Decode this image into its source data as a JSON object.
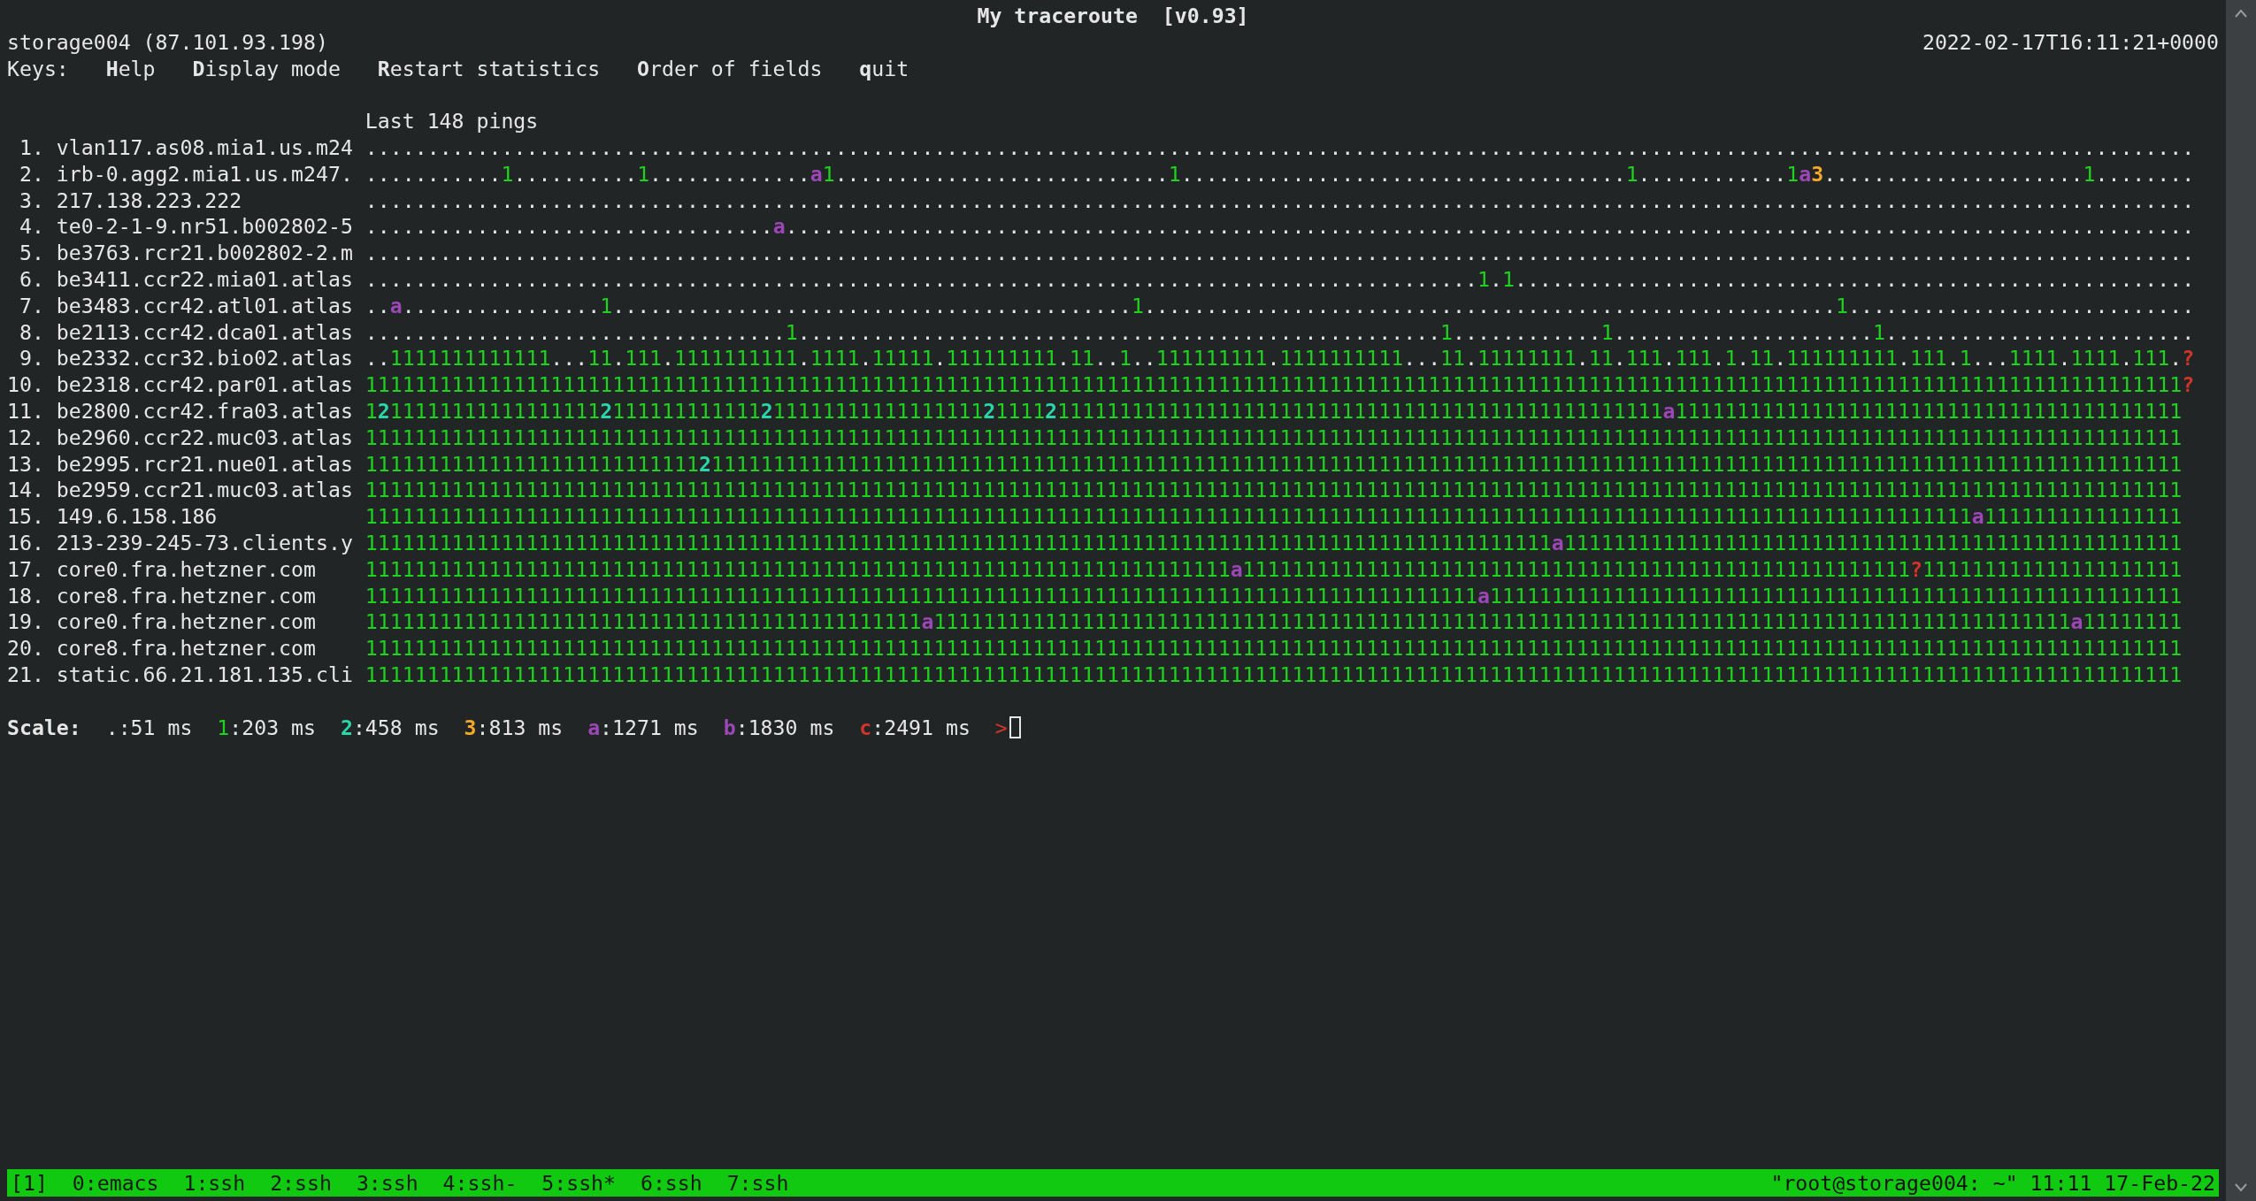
{
  "title": "My traceroute  [v0.93]",
  "host": "storage004 (87.101.93.198)",
  "timestamp": "2022-02-17T16:11:21+0000",
  "keys": {
    "label": "Keys:",
    "items": [
      "**H**elp",
      "**D**isplay mode",
      "**R**estart statistics",
      "**O**rder of fields",
      "**q**uit"
    ]
  },
  "pings_header": "Last 148 pings",
  "hops": [
    {
      "number": "1.",
      "host": "vlan117.as08.mia1.us.m24",
      "pings": "...................................................................................................................................................."
    },
    {
      "number": "2.",
      "host": "irb-0.agg2.mia1.us.m247.",
      "pings": "...........1..........1.............a1...........................1....................................1............1a3.....................1........"
    },
    {
      "number": "3.",
      "host": "217.138.223.222",
      "pings": "...................................................................................................................................................."
    },
    {
      "number": "4.",
      "host": "te0-2-1-9.nr51.b002802-5",
      "pings": ".................................a.................................................................................................................."
    },
    {
      "number": "5.",
      "host": "be3763.rcr21.b002802-2.m",
      "pings": "...................................................................................................................................................."
    },
    {
      "number": "6.",
      "host": "be3411.ccr22.mia01.atlas",
      "pings": "..........................................................................................1.1......................................................."
    },
    {
      "number": "7.",
      "host": "be3483.ccr42.atl01.atlas",
      "pings": "..a................1..........................................1........................................................1............................"
    },
    {
      "number": "8.",
      "host": "be2113.ccr42.dca01.atlas",
      "pings": "..................................1....................................................1............1.....................1........................."
    },
    {
      "number": "9.",
      "host": "be2332.ccr32.bio02.atlas",
      "pings": "..1111111111111...11.111.1111111111.1111.11111.111111111.11..1..111111111.1111111111...11.11111111.11.111.111.1.11.111111111.111.1...1111.1111.111.?"
    },
    {
      "number": "10.",
      "host": "be2318.ccr42.par01.atlas",
      "pings": "111111111111111111111111111111111111111111111111111111111111111111111111111111111111111111111111111111111111111111111111111111111111111111111111111?"
    },
    {
      "number": "11.",
      "host": "be2800.ccr42.fra03.atlas",
      "pings": "121111111111111111121111111111112111111111111111112111121111111111111111111111111111111111111111111111111a11111111111111111111111111111111111111111"
    },
    {
      "number": "12.",
      "host": "be2960.ccr22.muc03.atlas",
      "pings": "111111111111111111111111111111111111111111111111111111111111111111111111111111111111111111111111111111111111111111111111111111111111111111111111111"
    },
    {
      "number": "13.",
      "host": "be2995.rcr21.nue01.atlas",
      "pings": "111111111111111111111111111211111111111111111111111111111111111111111111111111111111111111111111111111111111111111111111111111111111111111111111111"
    },
    {
      "number": "14.",
      "host": "be2959.ccr21.muc03.atlas",
      "pings": "111111111111111111111111111111111111111111111111111111111111111111111111111111111111111111111111111111111111111111111111111111111111111111111111111"
    },
    {
      "number": "15.",
      "host": "149.6.158.186",
      "pings": "1111111111111111111111111111111111111111111111111111111111111111111111111111111111111111111111111111111111111111111111111111111111a1111111111111111"
    },
    {
      "number": "16.",
      "host": "213-239-245-73.clients.y",
      "pings": "111111111111111111111111111111111111111111111111111111111111111111111111111111111111111111111111a11111111111111111111111111111111111111111111111111"
    },
    {
      "number": "17.",
      "host": "core0.fra.hetzner.com",
      "pings": "1111111111111111111111111111111111111111111111111111111111111111111111a111111111111111111111111111111111111111111111111111111?111111111111111111111"
    },
    {
      "number": "18.",
      "host": "core8.fra.hetzner.com",
      "pings": "111111111111111111111111111111111111111111111111111111111111111111111111111111111111111111a11111111111111111111111111111111111111111111111111111111"
    },
    {
      "number": "19.",
      "host": "core0.fra.hetzner.com",
      "pings": "111111111111111111111111111111111111111111111a11111111111111111111111111111111111111111111111111111111111111111111111111111111111111111111a11111111"
    },
    {
      "number": "20.",
      "host": "core8.fra.hetzner.com",
      "pings": "111111111111111111111111111111111111111111111111111111111111111111111111111111111111111111111111111111111111111111111111111111111111111111111111111"
    },
    {
      "number": "21.",
      "host": "static.66.21.181.135.cli",
      "pings": "111111111111111111111111111111111111111111111111111111111111111111111111111111111111111111111111111111111111111111111111111111111111111111111111111"
    }
  ],
  "scale": {
    "label": "Scale:",
    "items": [
      {
        "symbol": ".",
        "value": ":51 ms",
        "color": "#e6e6e6",
        "bold": false
      },
      {
        "symbol": "1",
        "value": ":203 ms",
        "color": "#1fd21f",
        "bold": false
      },
      {
        "symbol": "2",
        "value": ":458 ms",
        "color": "#2ad6a6",
        "bold": true
      },
      {
        "symbol": "3",
        "value": ":813 ms",
        "color": "#f4a828",
        "bold": true
      },
      {
        "symbol": "a",
        "value": ":1271 ms",
        "color": "#9b47b6",
        "bold": true
      },
      {
        "symbol": "b",
        "value": ":1830 ms",
        "color": "#9b47b6",
        "bold": true
      },
      {
        "symbol": "c",
        "value": ":2491 ms",
        "color": "#d2342a",
        "bold": true
      }
    ]
  },
  "prompt": ">",
  "status_bar": {
    "session": "[1]",
    "windows": [
      {
        "label": "0:emacs"
      },
      {
        "label": "1:ssh"
      },
      {
        "label": "2:ssh"
      },
      {
        "label": "3:ssh"
      },
      {
        "label": "4:ssh-"
      },
      {
        "label": "5:ssh*"
      },
      {
        "label": "6:ssh"
      },
      {
        "label": "7:ssh"
      }
    ],
    "right": "\"root@storage004: ~\" 11:11 17-Feb-22"
  }
}
